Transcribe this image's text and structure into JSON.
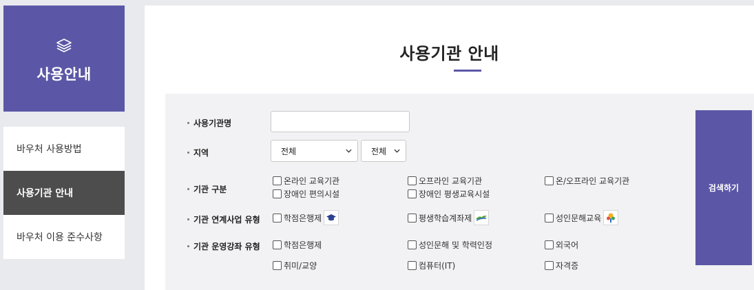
{
  "sidebar": {
    "title": "사용안내",
    "icon": "layers-icon",
    "items": [
      {
        "label": "바우처 사용방법",
        "active": false
      },
      {
        "label": "사용기관 안내",
        "active": true
      },
      {
        "label": "바우처 이용 준수사항",
        "active": false
      }
    ]
  },
  "main": {
    "title": "사용기관 안내"
  },
  "search": {
    "name_label": "사용기관명",
    "name_value": "",
    "region_label": "지역",
    "region_select_1": "전체",
    "region_select_2": "전체",
    "type_label": "기관 구분",
    "type_options": [
      "온라인 교육기관",
      "오프라인 교육기관",
      "온/오프라인 교육기관",
      "장애인 편의시설",
      "장애인 평생교육시설"
    ],
    "link_label": "기관 연계사업 유형",
    "link_options": [
      "학점은행제",
      "평생학습계좌제",
      "성인문해교육"
    ],
    "course_label": "기관 운영강좌 유형",
    "course_options": [
      "학점은행제",
      "성인문해 및 학력인정",
      "외국어",
      "취미/교양",
      "컴퓨터(IT)",
      "자격증"
    ],
    "button_label": "검색하기"
  },
  "colors": {
    "accent": "#5b57a6",
    "active_menu": "#4d4d4d",
    "panel": "#f2f2f4",
    "page_bg": "#e9eaee"
  }
}
